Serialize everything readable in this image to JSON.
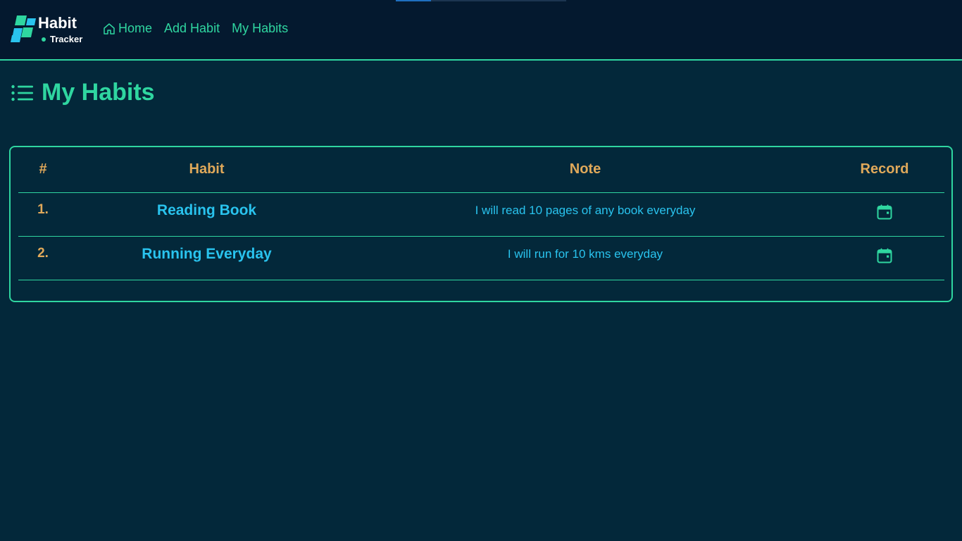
{
  "brand": {
    "title": "Habit",
    "subtitle": "Tracker",
    "logo_icon": "habit-tracker-logo",
    "colors": {
      "logo_primary": "#2fd6a0",
      "logo_secondary": "#29c3ee"
    }
  },
  "nav": {
    "items": [
      {
        "label": "Home",
        "icon": "home-icon"
      },
      {
        "label": "Add Habit"
      },
      {
        "label": "My Habits"
      }
    ]
  },
  "page": {
    "title": "My Habits",
    "title_icon": "list-icon"
  },
  "table": {
    "headers": {
      "num": "#",
      "habit": "Habit",
      "note": "Note",
      "record": "Record"
    },
    "rows": [
      {
        "num": "1.",
        "habit": "Reading Book",
        "note": "I will read 10 pages of any book everyday",
        "record_icon": "calendar-icon"
      },
      {
        "num": "2.",
        "habit": "Running Everyday",
        "note": "I will run for 10 kms everyday",
        "record_icon": "calendar-icon"
      }
    ]
  },
  "colors": {
    "background": "#03283a",
    "navbar": "#04192f",
    "accent": "#2fd6a0",
    "header_text": "#e0a95a",
    "habit_text": "#29c3ee"
  }
}
